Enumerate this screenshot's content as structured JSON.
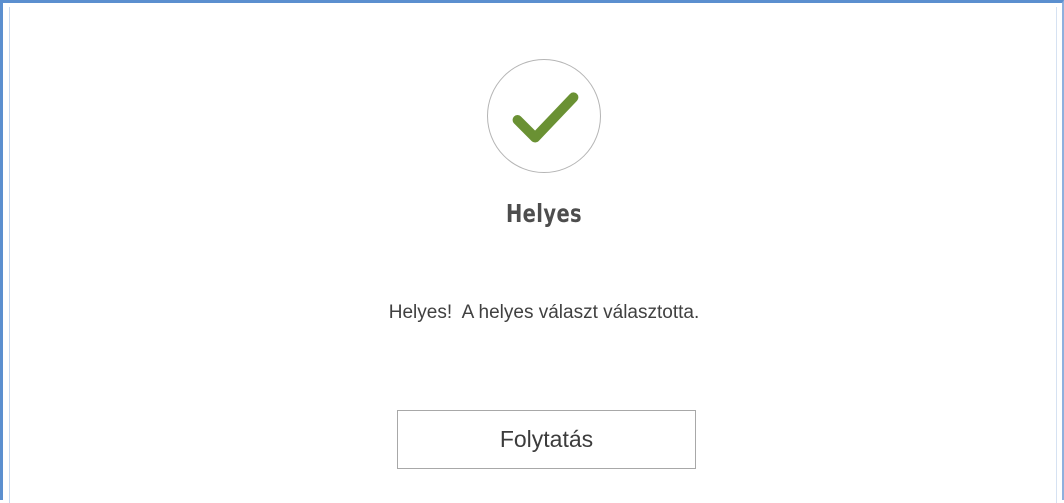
{
  "result": {
    "icon": "checkmark-icon",
    "icon_color": "#6a9133",
    "title": "Helyes",
    "message": "Helyes!  A helyes választ választotta."
  },
  "actions": {
    "continue_label": "Folytatás"
  }
}
